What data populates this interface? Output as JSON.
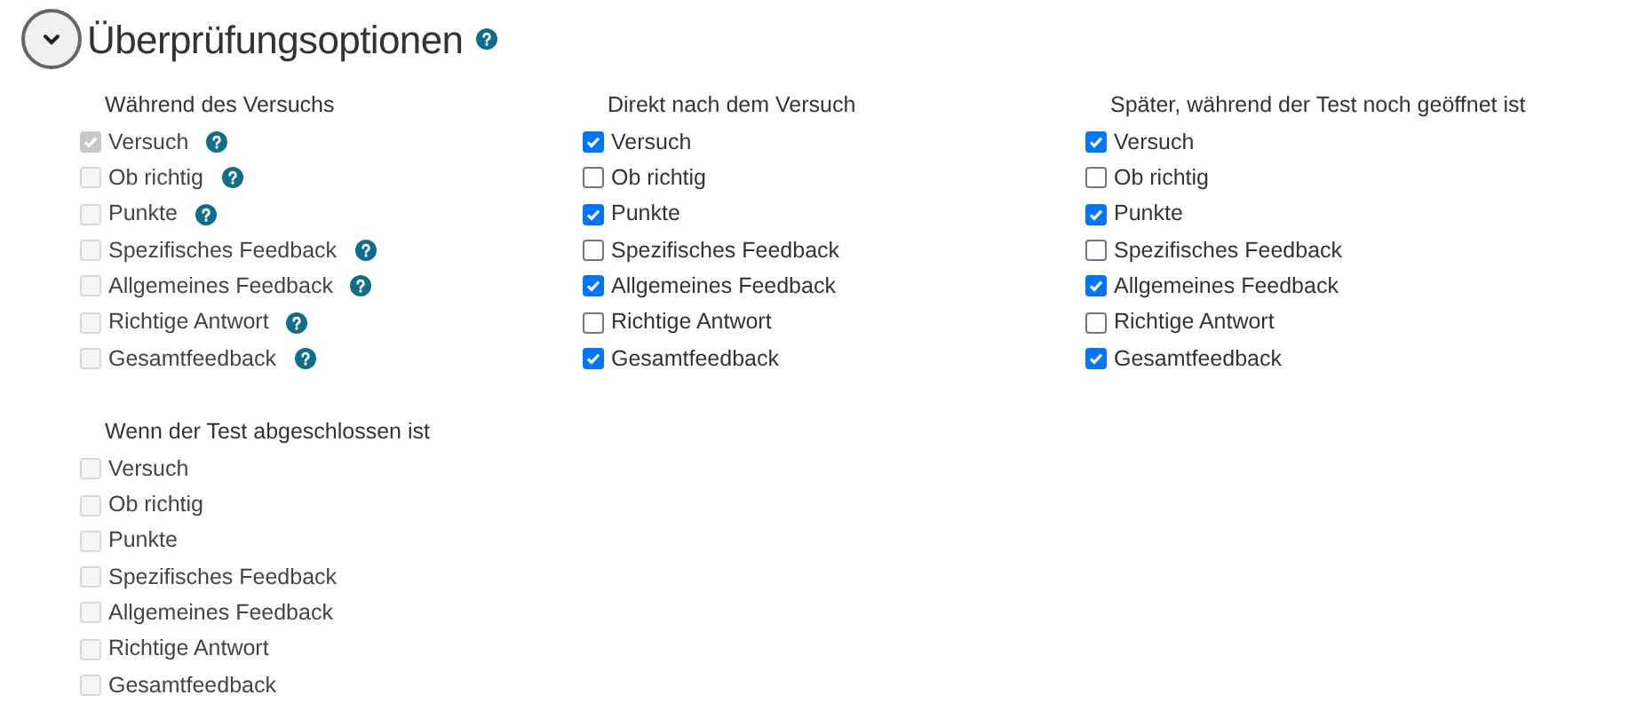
{
  "section": {
    "title": "Überprüfungsoptionen",
    "expanded": true,
    "help": true
  },
  "groups": [
    {
      "heading": "Während des Versuchs",
      "options": [
        {
          "label": "Versuch",
          "checked": true,
          "disabled": true,
          "help": true
        },
        {
          "label": "Ob richtig",
          "checked": false,
          "disabled": true,
          "help": true
        },
        {
          "label": "Punkte",
          "checked": false,
          "disabled": true,
          "help": true
        },
        {
          "label": "Spezifisches Feedback",
          "checked": false,
          "disabled": true,
          "help": true
        },
        {
          "label": "Allgemeines Feedback",
          "checked": false,
          "disabled": true,
          "help": true
        },
        {
          "label": "Richtige Antwort",
          "checked": false,
          "disabled": true,
          "help": true
        },
        {
          "label": "Gesamtfeedback",
          "checked": false,
          "disabled": true,
          "help": true
        }
      ]
    },
    {
      "heading": "Direkt nach dem Versuch",
      "options": [
        {
          "label": "Versuch",
          "checked": true,
          "disabled": false,
          "help": false
        },
        {
          "label": "Ob richtig",
          "checked": false,
          "disabled": false,
          "help": false
        },
        {
          "label": "Punkte",
          "checked": true,
          "disabled": false,
          "help": false
        },
        {
          "label": "Spezifisches Feedback",
          "checked": false,
          "disabled": false,
          "help": false
        },
        {
          "label": "Allgemeines Feedback",
          "checked": true,
          "disabled": false,
          "help": false
        },
        {
          "label": "Richtige Antwort",
          "checked": false,
          "disabled": false,
          "help": false
        },
        {
          "label": "Gesamtfeedback",
          "checked": true,
          "disabled": false,
          "help": false
        }
      ]
    },
    {
      "heading": "Später, während der Test noch geöffnet ist",
      "options": [
        {
          "label": "Versuch",
          "checked": true,
          "disabled": false,
          "help": false
        },
        {
          "label": "Ob richtig",
          "checked": false,
          "disabled": false,
          "help": false
        },
        {
          "label": "Punkte",
          "checked": true,
          "disabled": false,
          "help": false
        },
        {
          "label": "Spezifisches Feedback",
          "checked": false,
          "disabled": false,
          "help": false
        },
        {
          "label": "Allgemeines Feedback",
          "checked": true,
          "disabled": false,
          "help": false
        },
        {
          "label": "Richtige Antwort",
          "checked": false,
          "disabled": false,
          "help": false
        },
        {
          "label": "Gesamtfeedback",
          "checked": true,
          "disabled": false,
          "help": false
        }
      ]
    },
    {
      "heading": "Wenn der Test abgeschlossen ist",
      "options": [
        {
          "label": "Versuch",
          "checked": false,
          "disabled": true,
          "help": false
        },
        {
          "label": "Ob richtig",
          "checked": false,
          "disabled": true,
          "help": false
        },
        {
          "label": "Punkte",
          "checked": false,
          "disabled": true,
          "help": false
        },
        {
          "label": "Spezifisches Feedback",
          "checked": false,
          "disabled": true,
          "help": false
        },
        {
          "label": "Allgemeines Feedback",
          "checked": false,
          "disabled": true,
          "help": false
        },
        {
          "label": "Richtige Antwort",
          "checked": false,
          "disabled": true,
          "help": false
        },
        {
          "label": "Gesamtfeedback",
          "checked": false,
          "disabled": true,
          "help": false
        }
      ]
    }
  ]
}
